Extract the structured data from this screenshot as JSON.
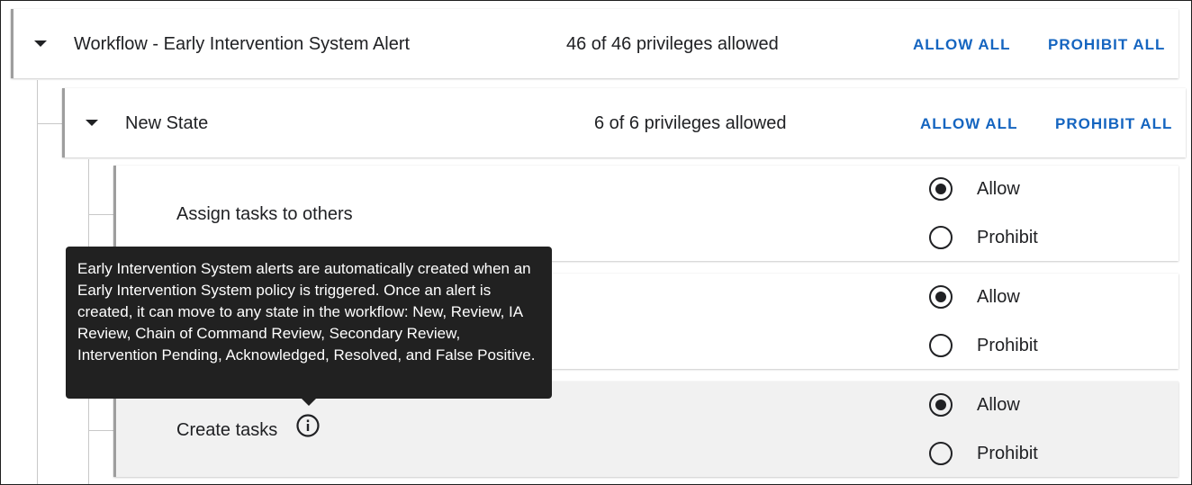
{
  "workflow": {
    "title": "Workflow - Early Intervention System Alert",
    "privileges": "46 of 46 privileges allowed",
    "allow_all": "ALLOW ALL",
    "prohibit_all": "PROHIBIT ALL"
  },
  "state": {
    "title": "New State",
    "privileges": "6 of 6 privileges allowed",
    "allow_all": "ALLOW ALL",
    "prohibit_all": "PROHIBIT ALL"
  },
  "privileges": [
    {
      "label": "Assign tasks to others",
      "allow": "Allow",
      "prohibit": "Prohibit",
      "selected": "allow"
    },
    {
      "label": "",
      "allow": "Allow",
      "prohibit": "Prohibit",
      "selected": "allow"
    },
    {
      "label": "Create tasks",
      "allow": "Allow",
      "prohibit": "Prohibit",
      "selected": "allow"
    }
  ],
  "tooltip": {
    "text": "Early Intervention System alerts are automatically created when an Early Intervention System policy is triggered. Once an alert is created, it can move to any state in the workflow: New, Review, IA Review, Chain of Command Review, Secondary Review, Intervention Pending, Acknowledged, Resolved, and False Positive."
  },
  "icons": [
    "caret-down-icon",
    "info-icon"
  ]
}
